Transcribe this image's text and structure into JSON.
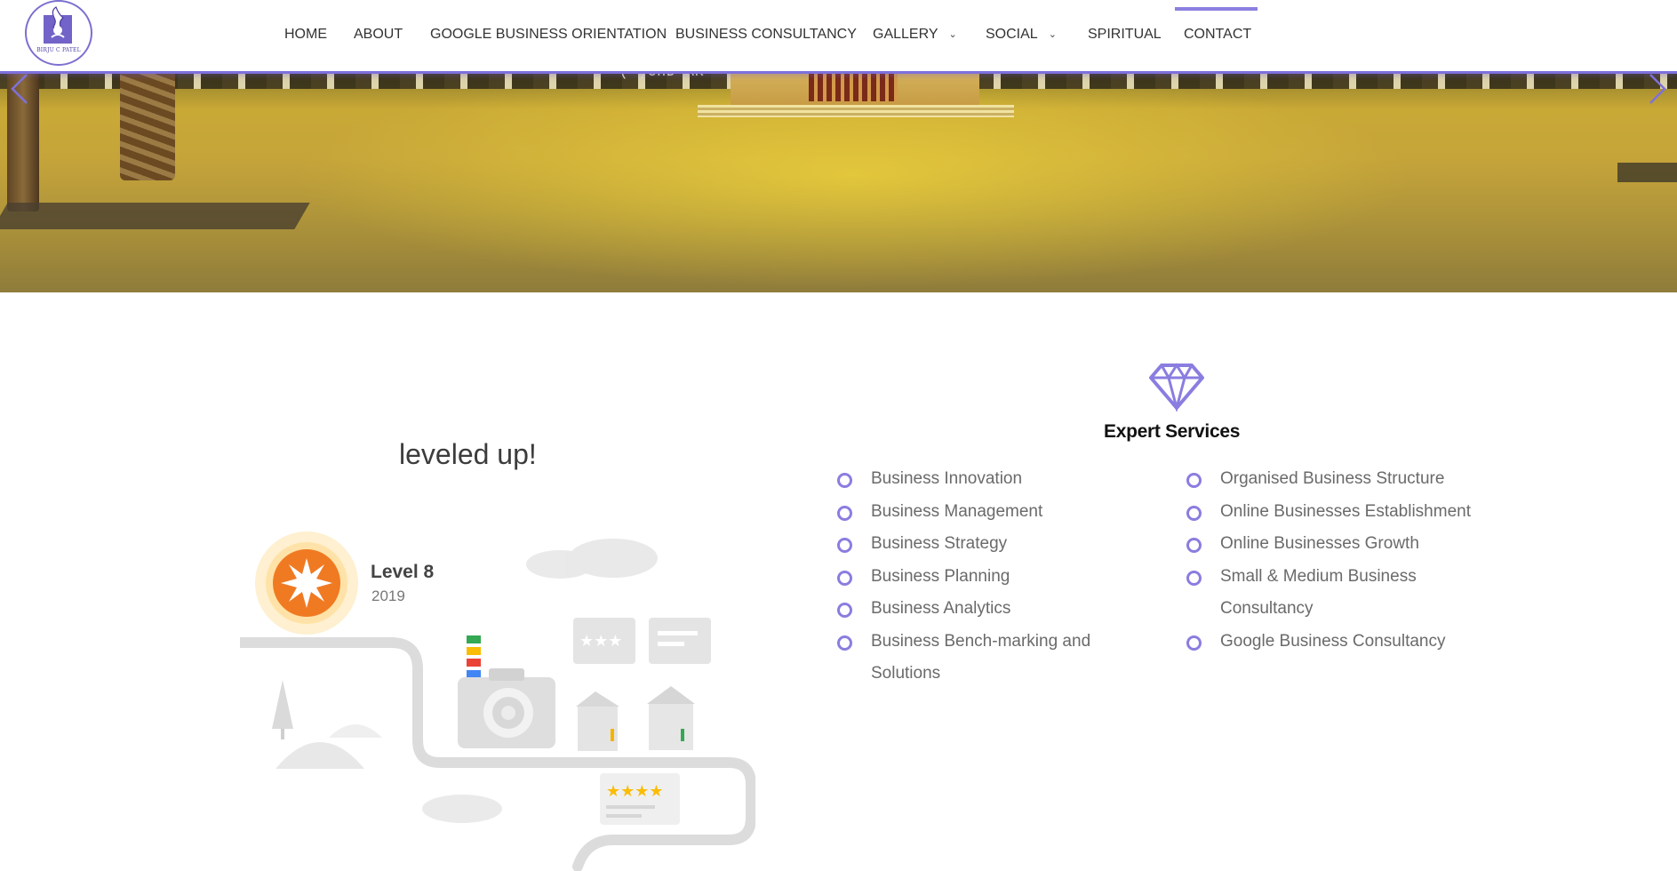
{
  "logo": {
    "text": "BIRJU C PATEL"
  },
  "nav": {
    "items": [
      {
        "label": "HOME",
        "dropdown": false
      },
      {
        "label": "ABOUT",
        "dropdown": false
      },
      {
        "label": "GOOGLE BUSINESS ORIENTATION",
        "dropdown": false
      },
      {
        "label": "BUSINESS CONSULTANCY",
        "dropdown": false
      },
      {
        "label": "GALLERY",
        "dropdown": true
      },
      {
        "label": "SOCIAL",
        "dropdown": true
      },
      {
        "label": "SPIRITUAL",
        "dropdown": false
      },
      {
        "label": "CONTACT",
        "dropdown": false
      }
    ],
    "active": "CONTACT"
  },
  "hero": {
    "sign_text": "(-)CHD AK"
  },
  "badge": {
    "headline": "leveled up!",
    "level": "Level 8",
    "year": "2019"
  },
  "services": {
    "icon": "diamond-icon",
    "title": "Expert Services",
    "left": [
      "Business Innovation",
      "Business Management",
      "Business Strategy",
      "Business Planning",
      "Business Analytics",
      "Business Bench-marking and Solutions"
    ],
    "right": [
      "Organised Business Structure",
      "Online Businesses Establishment",
      "Online Businesses Growth",
      "Small & Medium Business Consultancy",
      "Google Business Consultancy"
    ]
  },
  "colors": {
    "accent": "#8a7de0",
    "header_border": "#7e70dc",
    "badge_orange": "#f07a22"
  }
}
